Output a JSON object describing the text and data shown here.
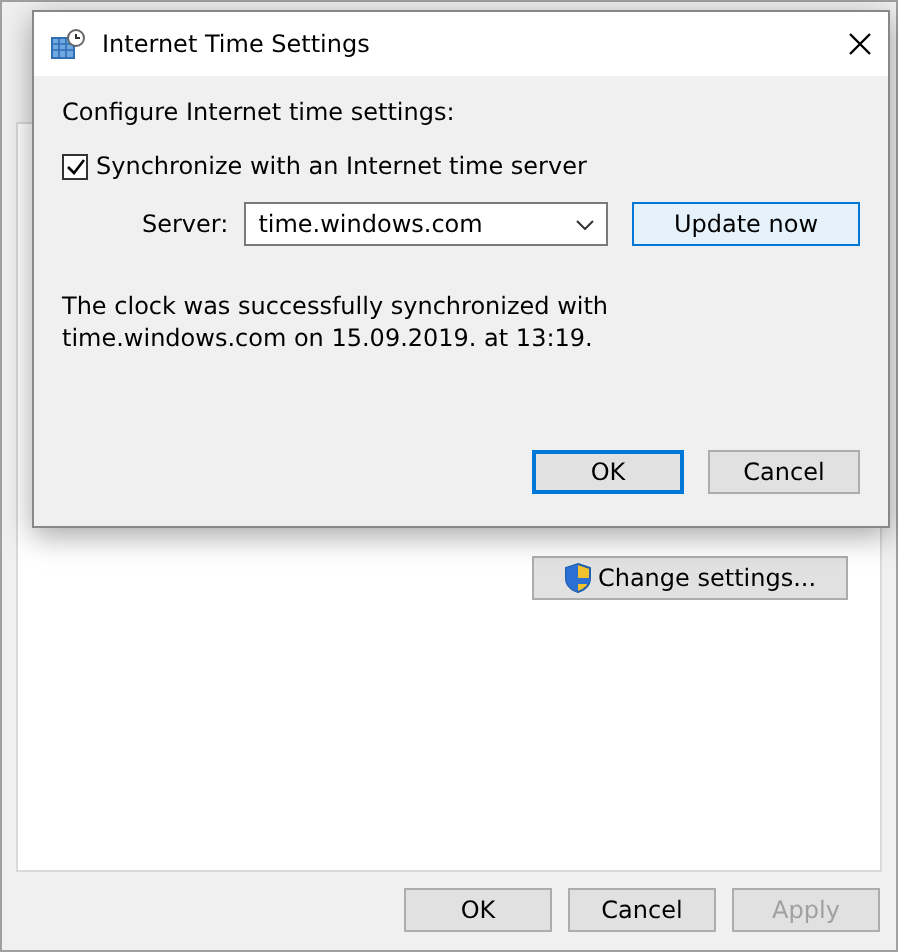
{
  "outer_window": {
    "change_settings_button": "Change settings...",
    "buttons": [
      {
        "label": "OK",
        "disabled": false
      },
      {
        "label": "Cancel",
        "disabled": false
      },
      {
        "label": "Apply",
        "disabled": true
      }
    ]
  },
  "dialog": {
    "title": "Internet Time Settings",
    "heading": "Configure Internet time settings:",
    "sync_checkbox": {
      "label": "Synchronize with an Internet time server",
      "checked": true
    },
    "server_label": "Server:",
    "server_value": "time.windows.com",
    "update_button": "Update now",
    "message": "The clock was successfully synchronized with time.windows.com on 15.09.2019. at 13:19.",
    "buttons": [
      {
        "label": "OK",
        "default": true
      },
      {
        "label": "Cancel",
        "default": false
      }
    ]
  }
}
